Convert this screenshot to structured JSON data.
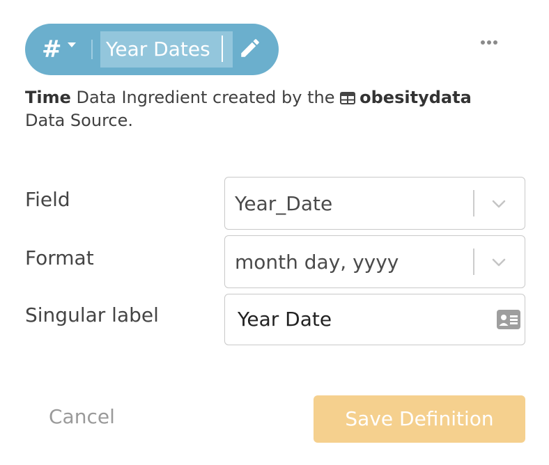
{
  "header": {
    "type_symbol": "#",
    "name_value": "Year Dates",
    "more_icon": "ellipsis-icon",
    "edit_icon": "pencil-icon",
    "pill_color": "#6bafcd"
  },
  "description": {
    "type_word": "Time",
    "middle_text": " Data Ingredient created by the ",
    "source_icon": "table-icon",
    "source_name": "obesitydata",
    "end_text": "Data Source."
  },
  "form": {
    "field": {
      "label": "Field",
      "value": "Year_Date"
    },
    "format": {
      "label": "Format",
      "value": "month day, yyyy"
    },
    "singular": {
      "label": "Singular label",
      "value": "Year Date",
      "icon": "contact-card-icon"
    }
  },
  "actions": {
    "cancel_label": "Cancel",
    "save_label": "Save Definition",
    "save_color": "#f5d08e"
  }
}
